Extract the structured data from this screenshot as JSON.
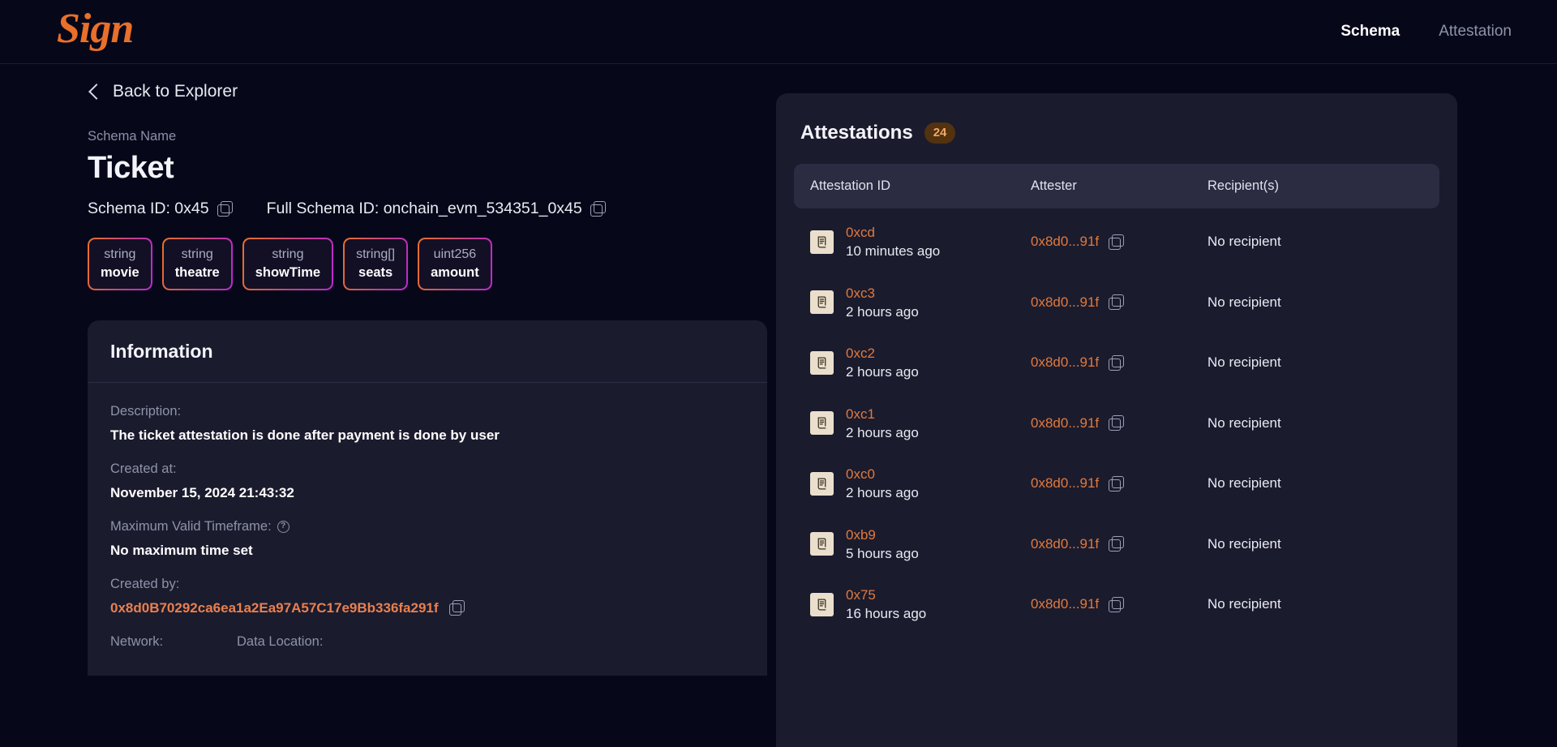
{
  "navbar": {
    "logo": "Sign",
    "links": [
      {
        "label": "Schema",
        "active": true
      },
      {
        "label": "Attestation",
        "active": false
      }
    ]
  },
  "back": {
    "label": "Back to Explorer",
    "icon": "chevron-left-icon"
  },
  "schema": {
    "name_label": "Schema Name",
    "name": "Ticket",
    "schema_id_label": "Schema ID: 0x45",
    "full_schema_id_label": "Full Schema ID: onchain_evm_534351_0x45",
    "fields": [
      {
        "type": "string",
        "name": "movie"
      },
      {
        "type": "string",
        "name": "theatre"
      },
      {
        "type": "string",
        "name": "showTime"
      },
      {
        "type": "string[]",
        "name": "seats"
      },
      {
        "type": "uint256",
        "name": "amount"
      }
    ]
  },
  "information": {
    "title": "Information",
    "description_label": "Description:",
    "description_value": "The ticket attestation is done after payment is done by user",
    "created_at_label": "Created at:",
    "created_at_value": "November 15, 2024 21:43:32",
    "max_timeframe_label": "Maximum Valid Timeframe:",
    "max_timeframe_help": "?",
    "max_timeframe_value": "No maximum time set",
    "created_by_label": "Created by:",
    "created_by_value": "0x8d0B70292ca6ea1a2Ea97A57C17e9Bb336fa291f",
    "network_label": "Network:",
    "data_location_label": "Data Location:"
  },
  "attestations": {
    "title": "Attestations",
    "count": "24",
    "columns": {
      "id": "Attestation ID",
      "attester": "Attester",
      "recipients": "Recipient(s)"
    },
    "rows": [
      {
        "id": "0xcd",
        "time": "10 minutes ago",
        "attester": "0x8d0...91f",
        "recipient": "No recipient"
      },
      {
        "id": "0xc3",
        "time": "2 hours ago",
        "attester": "0x8d0...91f",
        "recipient": "No recipient"
      },
      {
        "id": "0xc2",
        "time": "2 hours ago",
        "attester": "0x8d0...91f",
        "recipient": "No recipient"
      },
      {
        "id": "0xc1",
        "time": "2 hours ago",
        "attester": "0x8d0...91f",
        "recipient": "No recipient"
      },
      {
        "id": "0xc0",
        "time": "2 hours ago",
        "attester": "0x8d0...91f",
        "recipient": "No recipient"
      },
      {
        "id": "0xb9",
        "time": "5 hours ago",
        "attester": "0x8d0...91f",
        "recipient": "No recipient"
      },
      {
        "id": "0x75",
        "time": "16 hours ago",
        "attester": "0x8d0...91f",
        "recipient": "No recipient"
      }
    ]
  },
  "colors": {
    "page_bg": "#07071a",
    "panel_bg": "#1b1b2e",
    "table_header_bg": "#2b2b42",
    "accent_orange": "#e8702a",
    "link_orange": "#e07a3c",
    "badge_bg": "#52320f",
    "badge_text": "#f0a868",
    "muted_text": "#8d93a8",
    "primary_text": "#f2f4fa",
    "chip_gradient_start": "#e8702a",
    "chip_gradient_end": "#c026d3"
  }
}
